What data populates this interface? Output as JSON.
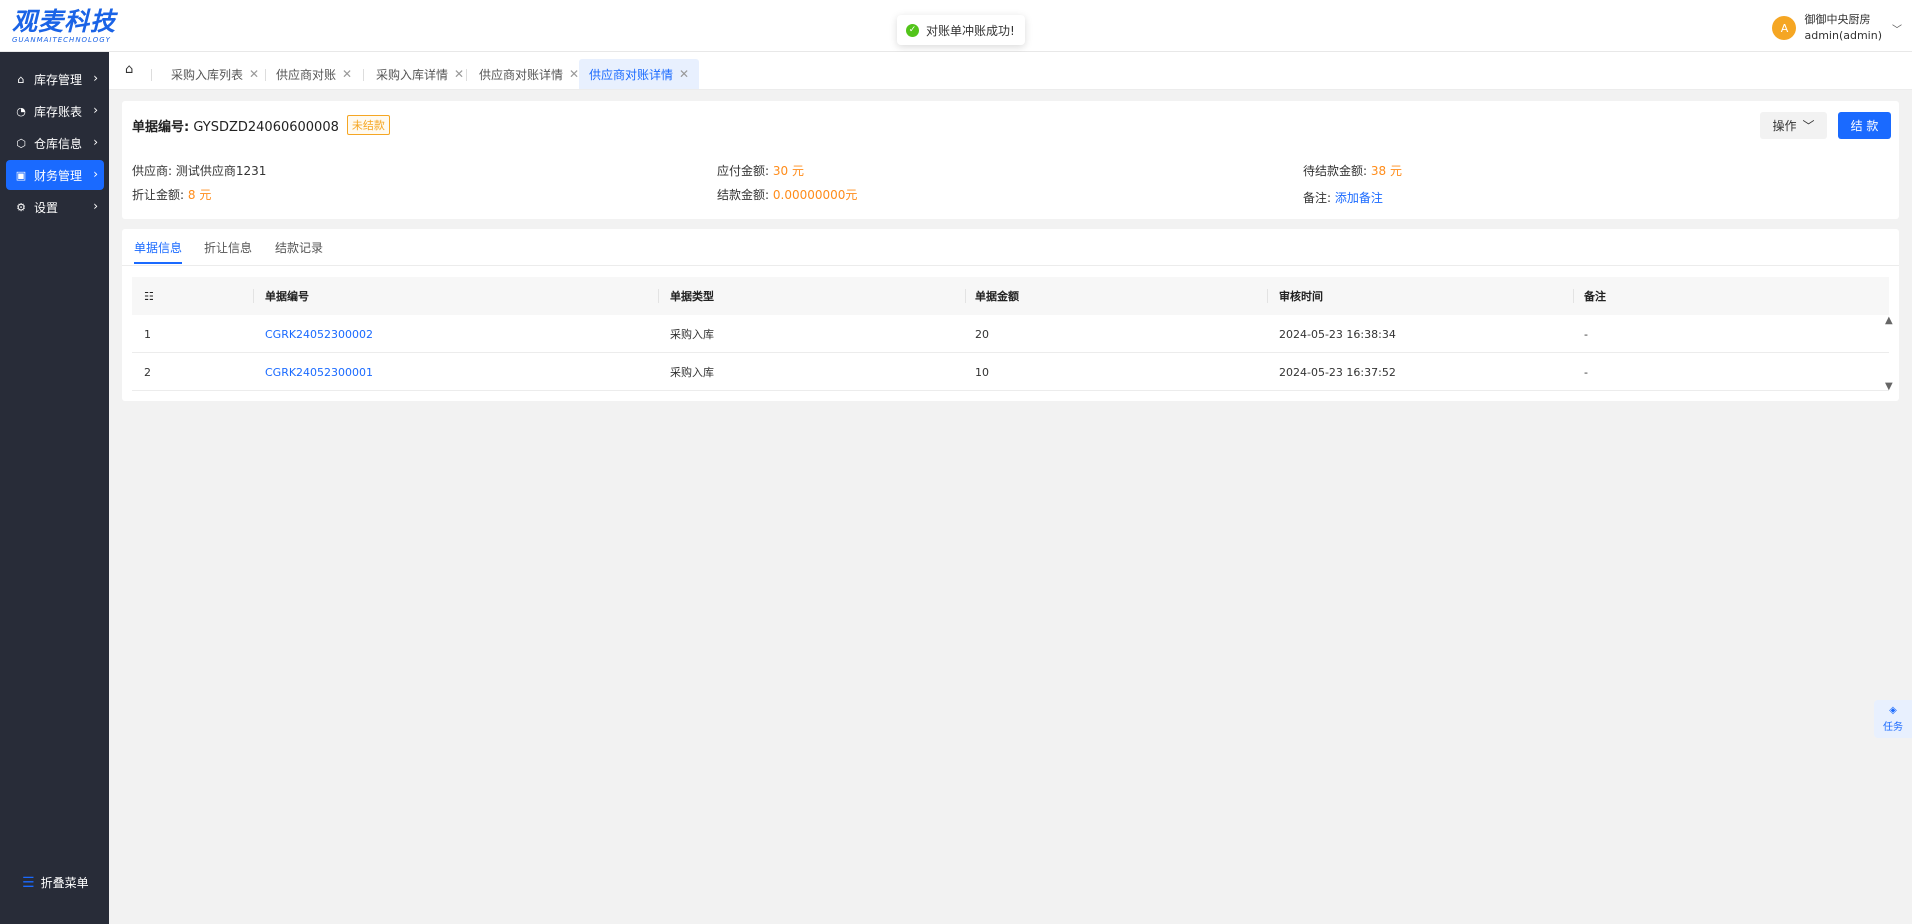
{
  "logo": {
    "cn": "观麦科技",
    "en": "GUANMAITECHNOLOGY"
  },
  "toast": {
    "message": "对账单冲账成功!"
  },
  "user": {
    "avatar_letter": "A",
    "org": "御御中央厨房",
    "account": "admin(admin)"
  },
  "sidebar": {
    "items": [
      {
        "label": "库存管理",
        "icon": "home-icon"
      },
      {
        "label": "库存账表",
        "icon": "chart-pie-icon"
      },
      {
        "label": "仓库信息",
        "icon": "box-icon"
      },
      {
        "label": "财务管理",
        "icon": "wallet-icon",
        "active": true
      },
      {
        "label": "设置",
        "icon": "gear-icon"
      }
    ],
    "collapse_label": "折叠菜单"
  },
  "tabs": [
    {
      "label": "采购入库列表"
    },
    {
      "label": "供应商对账"
    },
    {
      "label": "采购入库详情"
    },
    {
      "label": "供应商对账详情"
    },
    {
      "label": "供应商对账详情",
      "active": true
    }
  ],
  "doc": {
    "number_label": "单据编号:",
    "number": "GYSDZD24060600008",
    "status": "未结款",
    "op_button": "操作",
    "settle_button": "结 款",
    "supplier_label": "供应商:",
    "supplier": "测试供应商1231",
    "payable_label": "应付金额:",
    "payable": "30 元",
    "pending_label": "待结款金额:",
    "pending": "38 元",
    "discount_label": "折让金额:",
    "discount": "8 元",
    "settled_label": "结款金额:",
    "settled": "0.00000000元",
    "remark_label": "备注:",
    "remark_link": "添加备注"
  },
  "subtabs": [
    "单据信息",
    "折让信息",
    "结款记录"
  ],
  "table": {
    "columns": [
      "单据编号",
      "单据类型",
      "单据金额",
      "审核时间",
      "备注"
    ],
    "rows": [
      {
        "idx": "1",
        "no": "CGRK24052300002",
        "type": "采购入库",
        "amount": "20",
        "time": "2024-05-23 16:38:34",
        "remark": "-"
      },
      {
        "idx": "2",
        "no": "CGRK24052300001",
        "type": "采购入库",
        "amount": "10",
        "time": "2024-05-23 16:37:52",
        "remark": "-"
      }
    ]
  },
  "task_label": "任务"
}
